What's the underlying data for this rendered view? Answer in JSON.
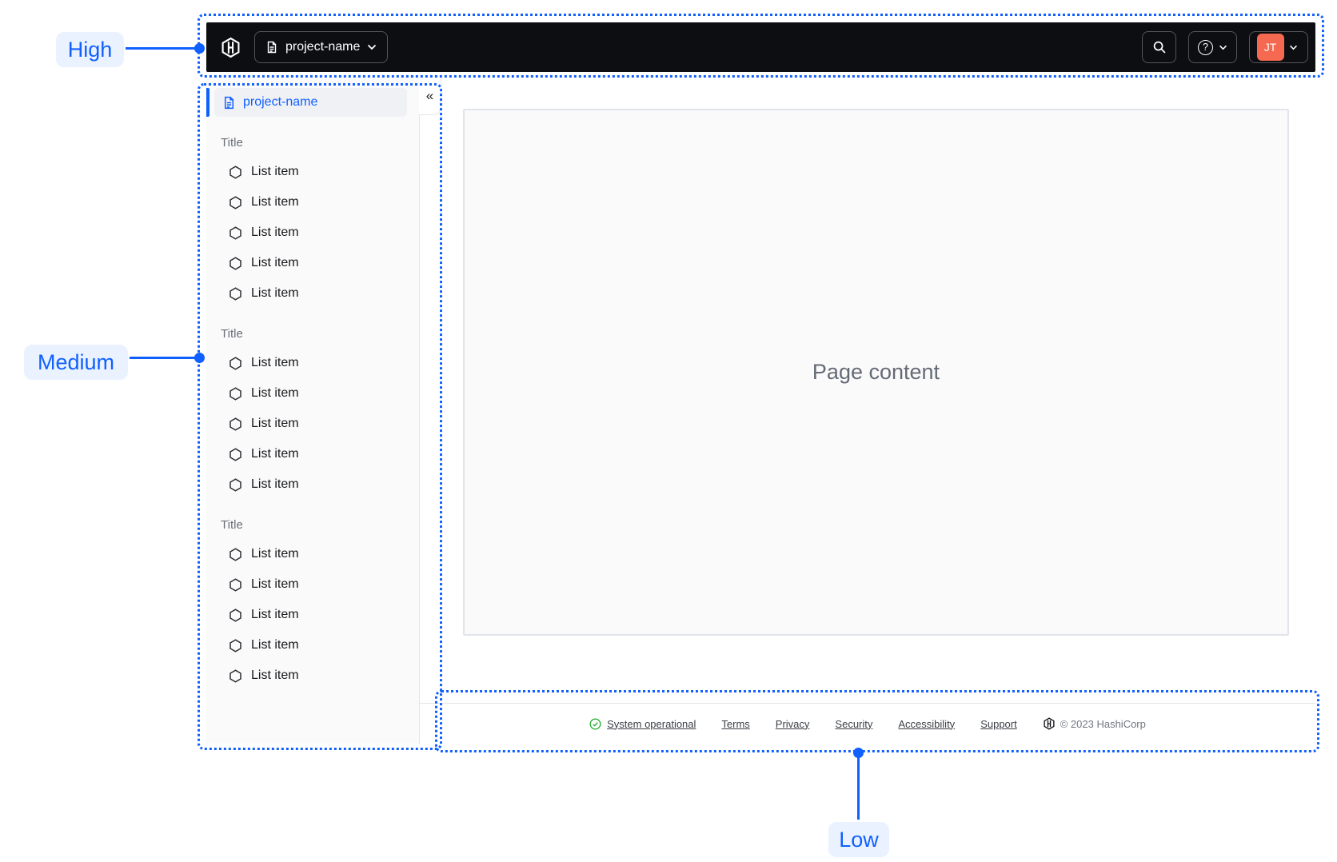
{
  "annotations": {
    "high_label": "High",
    "medium_label": "Medium",
    "low_label": "Low"
  },
  "navbar": {
    "project_dropdown_label": "project-name",
    "help_glyph": "?",
    "avatar_initials": "JT"
  },
  "sidebar": {
    "project_label": "project-name",
    "collapse_glyph": "«",
    "sections": [
      {
        "title": "Title",
        "items": [
          "List item",
          "List item",
          "List item",
          "List item",
          "List item"
        ]
      },
      {
        "title": "Title",
        "items": [
          "List item",
          "List item",
          "List item",
          "List item",
          "List item"
        ]
      },
      {
        "title": "Title",
        "items": [
          "List item",
          "List item",
          "List item",
          "List item",
          "List item"
        ]
      }
    ]
  },
  "main": {
    "placeholder": "Page content"
  },
  "footer": {
    "status_label": "System operational",
    "links": [
      "Terms",
      "Privacy",
      "Security",
      "Accessibility",
      "Support"
    ],
    "copyright": "© 2023 HashiCorp"
  },
  "colors": {
    "accent": "#1060FF",
    "accent_bg": "#EBF2FF",
    "navbar_bg": "#0D0E12",
    "avatar_bg": "#F4694F",
    "status_green": "#2EB039",
    "sidebar_bg": "#FAFAFA",
    "border": "#E3E5E9"
  }
}
